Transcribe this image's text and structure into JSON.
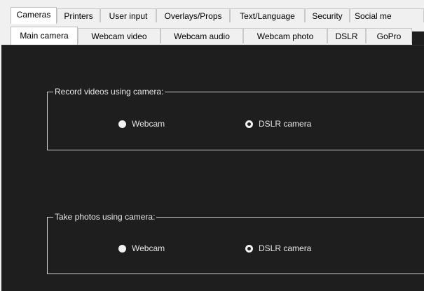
{
  "tabs_top": [
    {
      "label": "Cameras",
      "selected": true
    },
    {
      "label": "Printers"
    },
    {
      "label": "User input"
    },
    {
      "label": "Overlays/Props"
    },
    {
      "label": "Text/Language"
    },
    {
      "label": "Security"
    },
    {
      "label": "Social me"
    }
  ],
  "tabs_camera": [
    {
      "label": "Main camera",
      "selected": true
    },
    {
      "label": "Webcam video"
    },
    {
      "label": "Webcam audio"
    },
    {
      "label": "Webcam photo"
    },
    {
      "label": "DSLR"
    },
    {
      "label": "GoPro"
    }
  ],
  "record_group": {
    "legend": "Record videos using camera:",
    "options": [
      {
        "label": "Webcam",
        "state": "filled"
      },
      {
        "label": "DSLR camera",
        "state": "hollow"
      }
    ]
  },
  "photo_group": {
    "legend": "Take photos using camera:",
    "options": [
      {
        "label": "Webcam",
        "state": "filled"
      },
      {
        "label": "DSLR camera",
        "state": "hollow"
      }
    ]
  },
  "colors": {
    "panel_bg": "#1e1e1e",
    "tab_bg": "#f0f0f0",
    "text_light": "#e6e6e6"
  }
}
